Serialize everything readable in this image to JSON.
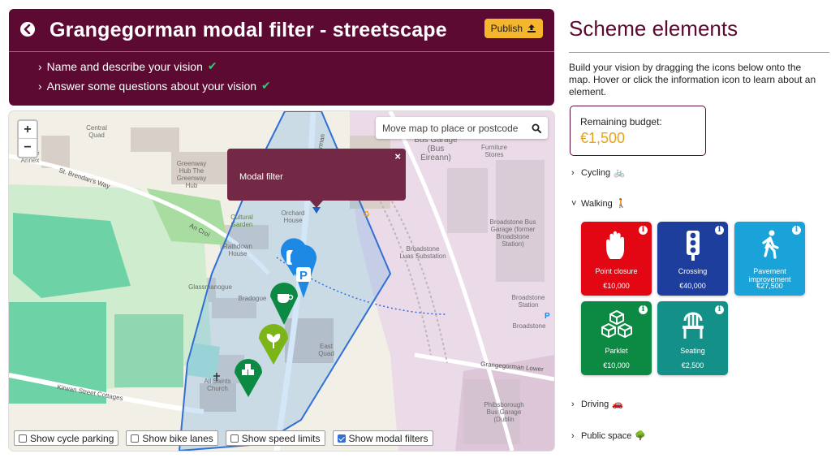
{
  "header": {
    "title": "Grangegorman modal filter - streetscape",
    "publish_label": "Publish",
    "steps": [
      {
        "label": "Name and describe your vision"
      },
      {
        "label": "Answer some questions about your vision"
      }
    ],
    "check_glyph": "✔",
    "chevron_glyph": "›"
  },
  "map": {
    "zoom_in": "+",
    "zoom_out": "−",
    "search_placeholder": "Move map to place or postcode",
    "popup_text": "Modal filter",
    "popup_close": "×",
    "labels": [
      "Central Quad",
      "North House Annex",
      "St. Brendan's Way",
      "Greenway Hub The Greenway Hub",
      "Cultural Garden",
      "An Croí",
      "Orchard House",
      "Rathdown House",
      "Glassmanogue",
      "Bradogue",
      "All Saints Church",
      "Kirwan Street Cottages",
      "East Quad",
      "Bus Garage (Bus Éireann)",
      "Furniture Stores",
      "Broadstone Luas Substation",
      "Broadstone Bus Garage (former Broadstone Station)",
      "Broadstone Station",
      "Phibsborough Bus Garage (Dublin",
      "Grangegorman Lower",
      "Broadstone",
      "Grangegorman"
    ],
    "toggles": [
      {
        "label": "Show cycle parking",
        "checked": false
      },
      {
        "label": "Show bike lanes",
        "checked": false
      },
      {
        "label": "Show speed limits",
        "checked": false
      },
      {
        "label": "Show modal filters",
        "checked": true
      }
    ]
  },
  "sidebar": {
    "title": "Scheme elements",
    "intro": "Build your vision by dragging the icons below onto the map. Hover or click the information icon to learn about an element.",
    "budget_label": "Remaining budget:",
    "budget_value": "€1,500",
    "categories": [
      {
        "label": "Cycling",
        "emoji": "🚲",
        "expanded": false
      },
      {
        "label": "Walking",
        "emoji": "🚶",
        "expanded": true
      },
      {
        "label": "Driving",
        "emoji": "🚗",
        "expanded": false
      },
      {
        "label": "Public space",
        "emoji": "🌳",
        "expanded": false
      }
    ],
    "elements": [
      {
        "name": "Point closure",
        "cost": "€10,000",
        "color": "#e30613",
        "icon": "hand-icon"
      },
      {
        "name": "Crossing",
        "cost": "€40,000",
        "color": "#1d3e9c",
        "icon": "traffic-light-icon"
      },
      {
        "name": "Pavement improvement",
        "cost": "€27,500",
        "color": "#1aa3d9",
        "icon": "walking-person-icon"
      },
      {
        "name": "Parklet",
        "cost": "€10,000",
        "color": "#0c8a43",
        "icon": "boxes-icon"
      },
      {
        "name": "Seating",
        "cost": "€2,500",
        "color": "#139088",
        "icon": "chair-icon"
      }
    ],
    "info_glyph": "i"
  },
  "colors": {
    "brand": "#5c0a32",
    "accent": "#f5b52c",
    "budget": "#e8a21b",
    "popup": "#732946",
    "scheme_outline": "#2f6fd6"
  }
}
